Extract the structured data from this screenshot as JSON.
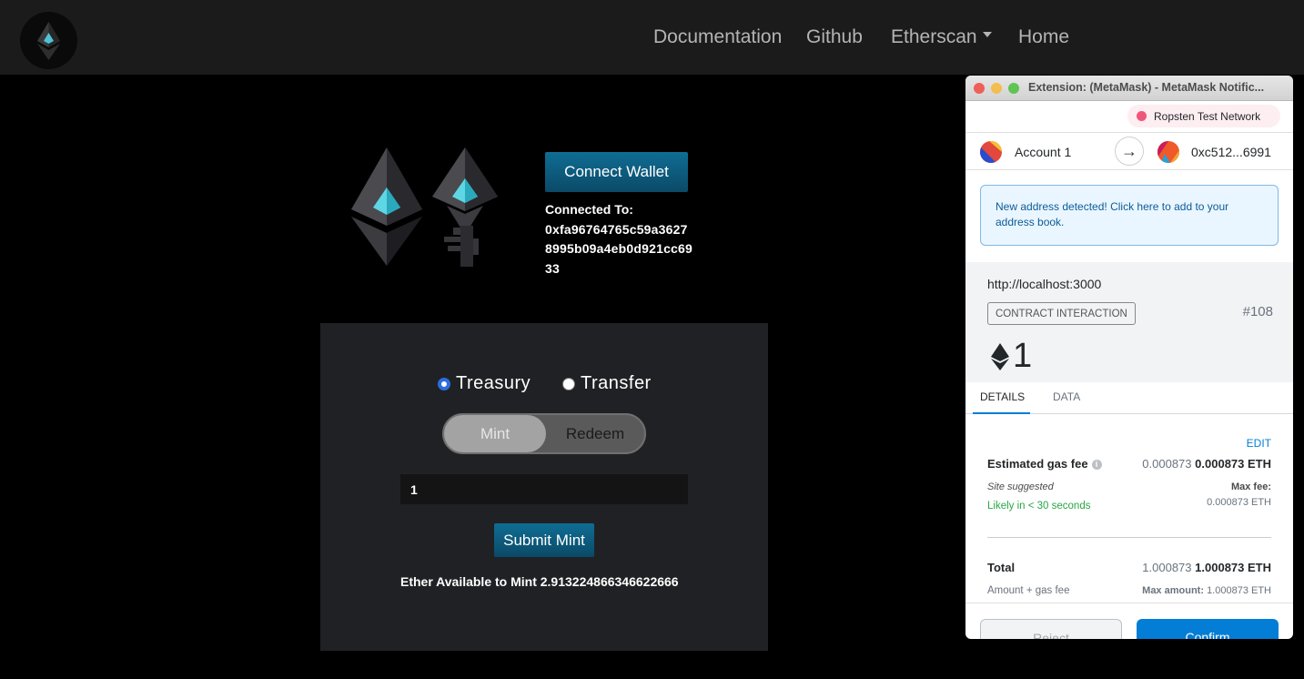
{
  "navbar": {
    "links": {
      "documentation": "Documentation",
      "github": "Github",
      "etherscan": "Etherscan",
      "home": "Home"
    }
  },
  "hero": {
    "connect_label": "Connect Wallet",
    "connected_label": "Connected To:",
    "address_lines": [
      "0xfa96764765c59a3627",
      "8995b09a4eb0d921cc69",
      "33"
    ]
  },
  "panel": {
    "radio_treasury": "Treasury",
    "radio_transfer": "Transfer",
    "selected_radio": "Treasury",
    "toggle_mint": "Mint",
    "toggle_redeem": "Redeem",
    "amount_value": "1",
    "submit_label": "Submit Mint",
    "available_text": "Ether Available to Mint 2.913224866346622666"
  },
  "metamask": {
    "window_title": "Extension: (MetaMask) - MetaMask Notific...",
    "network": "Ropsten Test Network",
    "from_account": "Account 1",
    "to_address": "0xc512...6991",
    "notice": "New address detected! Click here to add to your address book.",
    "origin": "http://localhost:3000",
    "badge": "CONTRACT INTERACTION",
    "tx_number": "#108",
    "amount": "1",
    "tab_details": "DETAILS",
    "tab_data": "DATA",
    "edit": "EDIT",
    "gas_label": "Estimated gas fee",
    "gas_value_muted": "0.000873",
    "gas_value": "0.000873 ETH",
    "site_suggested": "Site suggested",
    "max_fee_label": "Max fee:",
    "likely": "Likely in < 30 seconds",
    "max_fee_value": "0.000873 ETH",
    "total_label": "Total",
    "total_muted": "1.000873",
    "total_value": "1.000873 ETH",
    "amount_gas": "Amount + gas fee",
    "max_amount_label": "Max amount:",
    "max_amount_value": "1.000873 ETH",
    "reject": "Reject",
    "confirm": "Confirm",
    "colors": {
      "accent": "#037dd6",
      "network_dot": "#f2557a",
      "success": "#28a745"
    }
  }
}
